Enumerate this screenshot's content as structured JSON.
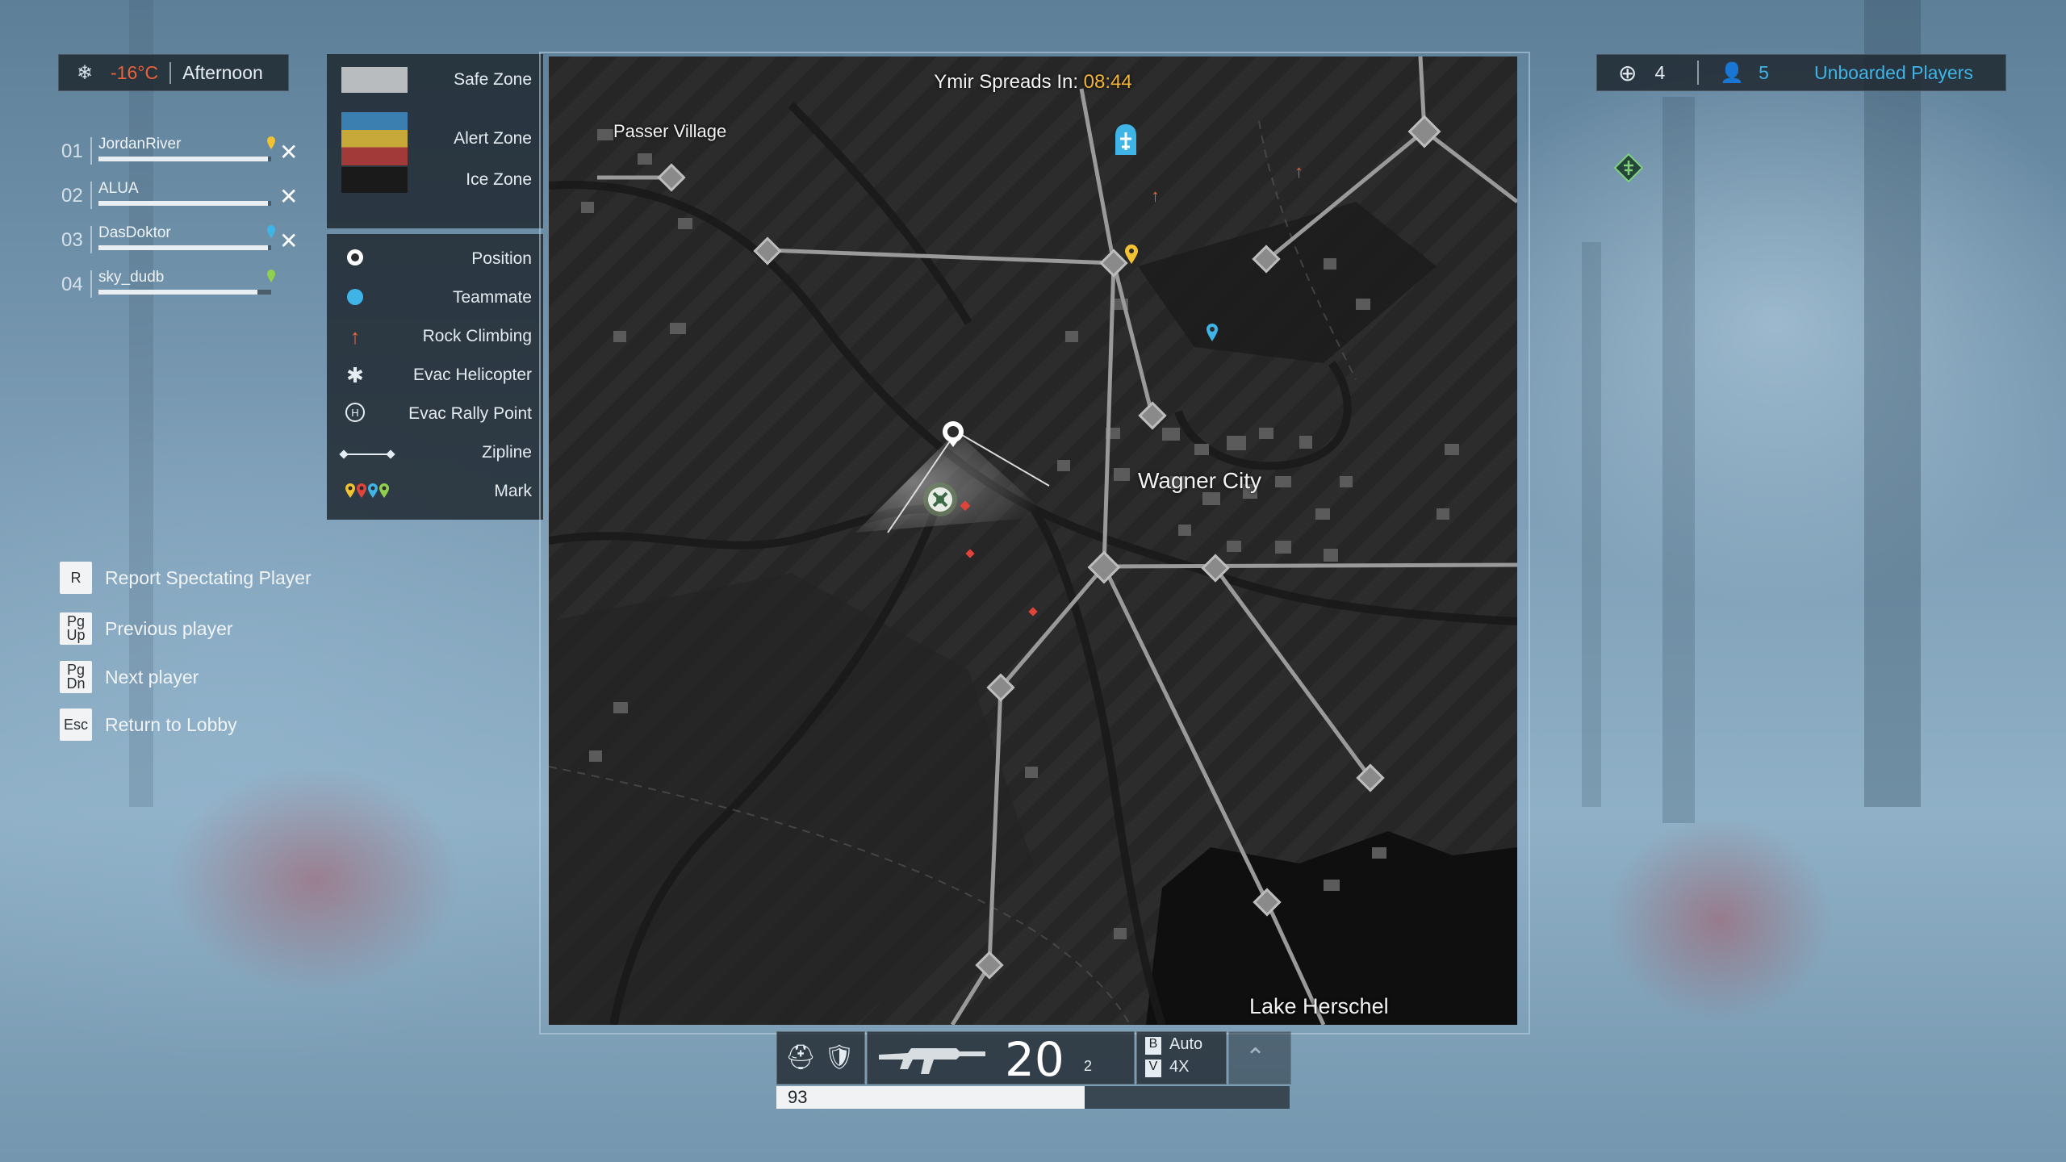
{
  "weather": {
    "icon": "weather-icon",
    "temperature": "-16°C",
    "time_of_day": "Afternoon"
  },
  "squad": [
    {
      "num": "01",
      "name": "JordanRiver",
      "hp": 0.98,
      "mark_color": "#f1c232",
      "removable": true
    },
    {
      "num": "02",
      "name": "ALUA",
      "hp": 0.98,
      "mark_color": "",
      "removable": true
    },
    {
      "num": "03",
      "name": "DasDoktor",
      "hp": 0.98,
      "mark_color": "#3fb4e6",
      "removable": true
    },
    {
      "num": "04",
      "name": "sky_dudb",
      "hp": 0.92,
      "mark_color": "#8fd14f",
      "removable": false
    }
  ],
  "hints": [
    {
      "key": "R",
      "label": "Report Spectating Player"
    },
    {
      "key": "Pg\nUp",
      "label": "Previous player"
    },
    {
      "key": "Pg\nDn",
      "label": "Next player"
    },
    {
      "key": "Esc",
      "label": "Return to Lobby"
    }
  ],
  "legend": {
    "zones": [
      {
        "label": "Safe Zone",
        "color": "#b9bcbe"
      },
      {
        "label": "Alert Zone",
        "colors": [
          "#3a7fb0",
          "#c7a93a",
          "#a33a3a"
        ]
      },
      {
        "label": "Ice Zone",
        "color": "#1a1a1a"
      }
    ],
    "markers": [
      {
        "icon": "position-icon",
        "label": "Position"
      },
      {
        "icon": "teammate-icon",
        "label": "Teammate"
      },
      {
        "icon": "rock-climbing-icon",
        "label": "Rock Climbing"
      },
      {
        "icon": "evac-helicopter-icon",
        "label": "Evac Helicopter"
      },
      {
        "icon": "evac-rally-point-icon",
        "label": "Evac Rally Point"
      },
      {
        "icon": "zipline-icon",
        "label": "Zipline"
      },
      {
        "icon": "mark-icon",
        "label": "Mark"
      }
    ],
    "mark_colors": [
      "#f1c232",
      "#e0433a",
      "#3fb4e6",
      "#8fd14f"
    ],
    "teammate_color": "#3fb4e6",
    "rock_climbing_color": "#e8623a"
  },
  "map": {
    "spread_label": "Ymir Spreads In:",
    "spread_time": "08:44",
    "locations": [
      "Passer Village",
      "Wagner City",
      "Lake Herschel"
    ]
  },
  "top_right": {
    "kills_icon": "crosshair-icon",
    "kills": "4",
    "players_icon": "player-icon",
    "players": "5",
    "status": "Unboarded Players",
    "status_color": "#3fb4e6"
  },
  "hud": {
    "weapon_icon": "assault-rifle-icon",
    "ammo": "20",
    "reserve": "2",
    "fire_mode_key": "B",
    "fire_mode": "Auto",
    "scope_key": "V",
    "scope": "4X",
    "health": "93",
    "health_fraction": 0.6
  }
}
